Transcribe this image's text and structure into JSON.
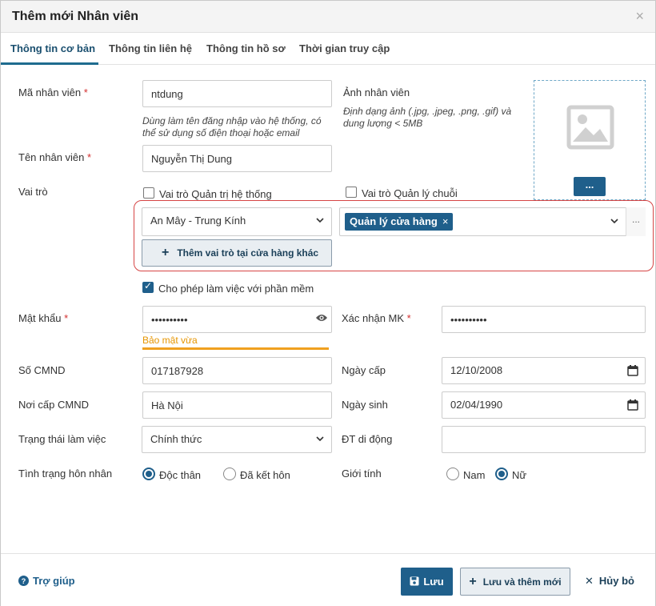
{
  "dialog": {
    "title": "Thêm mới Nhân viên",
    "close_icon": "×"
  },
  "tabs": [
    {
      "label": "Thông tin cơ bản",
      "active": true
    },
    {
      "label": "Thông tin liên hệ",
      "active": false
    },
    {
      "label": "Thông tin hồ sơ",
      "active": false
    },
    {
      "label": "Thời gian truy cập",
      "active": false
    }
  ],
  "form": {
    "employee_code": {
      "label": "Mã nhân viên",
      "value": "ntdung",
      "hint_line1": "Dùng làm tên đăng nhập vào hệ thống, có",
      "hint_line2": "thể sử dụng số điện thoại hoặc email"
    },
    "photo": {
      "label": "Ảnh nhân viên",
      "hint_line1": "Định dạng ảnh (.jpg, .jpeg, .png, .gif) và",
      "hint_line2": "dung lượng < 5MB",
      "button": "..."
    },
    "employee_name": {
      "label": "Tên nhân viên",
      "value": "Nguyễn Thị Dung"
    },
    "role": {
      "label": "Vai trò",
      "admin_checkbox": "Vai trò Quản trị hệ thống",
      "chain_checkbox": "Vai trò Quản lý chuỗi",
      "store_value": "An Mây - Trung Kính",
      "role_tag": "Quản lý cửa hàng",
      "tag_remove": "×",
      "more": "...",
      "add_button": "Thêm vai trò tại cửa hàng khác",
      "add_plus": "+"
    },
    "software_access": {
      "label": "Cho phép làm việc với phần mềm",
      "checked": true
    },
    "password": {
      "label": "Mật khẩu",
      "value": "••••••••••",
      "strength": "Bảo mật vừa"
    },
    "confirm_password": {
      "label": "Xác nhận MK",
      "value": "••••••••••"
    },
    "id_number": {
      "label": "Số CMND",
      "value": "017187928"
    },
    "issue_date": {
      "label": "Ngày cấp",
      "value": "12/10/2008"
    },
    "issue_place": {
      "label": "Nơi cấp CMND",
      "value": "Hà Nội"
    },
    "birth_date": {
      "label": "Ngày sinh",
      "value": "02/04/1990"
    },
    "work_status": {
      "label": "Trạng thái làm việc",
      "value": "Chính thức"
    },
    "mobile": {
      "label": "ĐT di động",
      "value": ""
    },
    "marital_status": {
      "label": "Tình trạng hôn nhân",
      "option_single": "Độc thân",
      "option_married": "Đã kết hôn",
      "selected": "Độc thân"
    },
    "gender": {
      "label": "Giới tính",
      "option_male": "Nam",
      "option_female": "Nữ",
      "selected": "Nữ"
    },
    "required_mark": "*"
  },
  "footer": {
    "help": "Trợ giúp",
    "save": "Lưu",
    "save_new": "Lưu và thêm mới",
    "save_new_plus": "+",
    "cancel": "Hủy bỏ",
    "cancel_x": "✕"
  },
  "colors": {
    "primary": "#1f5f8b",
    "highlight": "#d64545",
    "password_medium": "#f0a020",
    "required": "#d32f2f"
  }
}
